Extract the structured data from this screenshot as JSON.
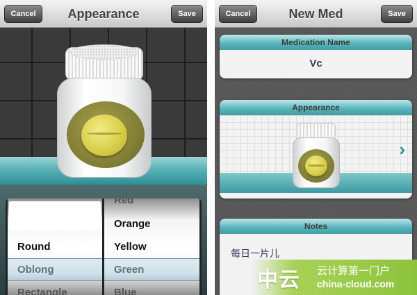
{
  "appearance_screen": {
    "cancel_label": "Cancel",
    "title": "Appearance",
    "save_label": "Save",
    "picker": {
      "shape_options": [
        "",
        "Round",
        "Oblong",
        "Rectangle"
      ],
      "selected_shape": "Oblong",
      "color_options": [
        "Red",
        "Orange",
        "Yellow",
        "Green",
        "Blue"
      ],
      "selected_color": "Green"
    }
  },
  "new_med_screen": {
    "cancel_label": "Cancel",
    "title": "New Med",
    "save_label": "Save",
    "medication_name_header": "Medication Name",
    "medication_name_value": "Vc",
    "appearance_header": "Appearance",
    "notes_header": "Notes",
    "notes_value": "每日一片儿"
  },
  "watermark": {
    "brand": "中云",
    "tagline": "云计算第一门户",
    "domain": "china-cloud.com"
  },
  "colors": {
    "accent_teal": "#3f9ca2",
    "pill_yellow": "#d9cf4b",
    "label_olive": "#7d7a33"
  }
}
